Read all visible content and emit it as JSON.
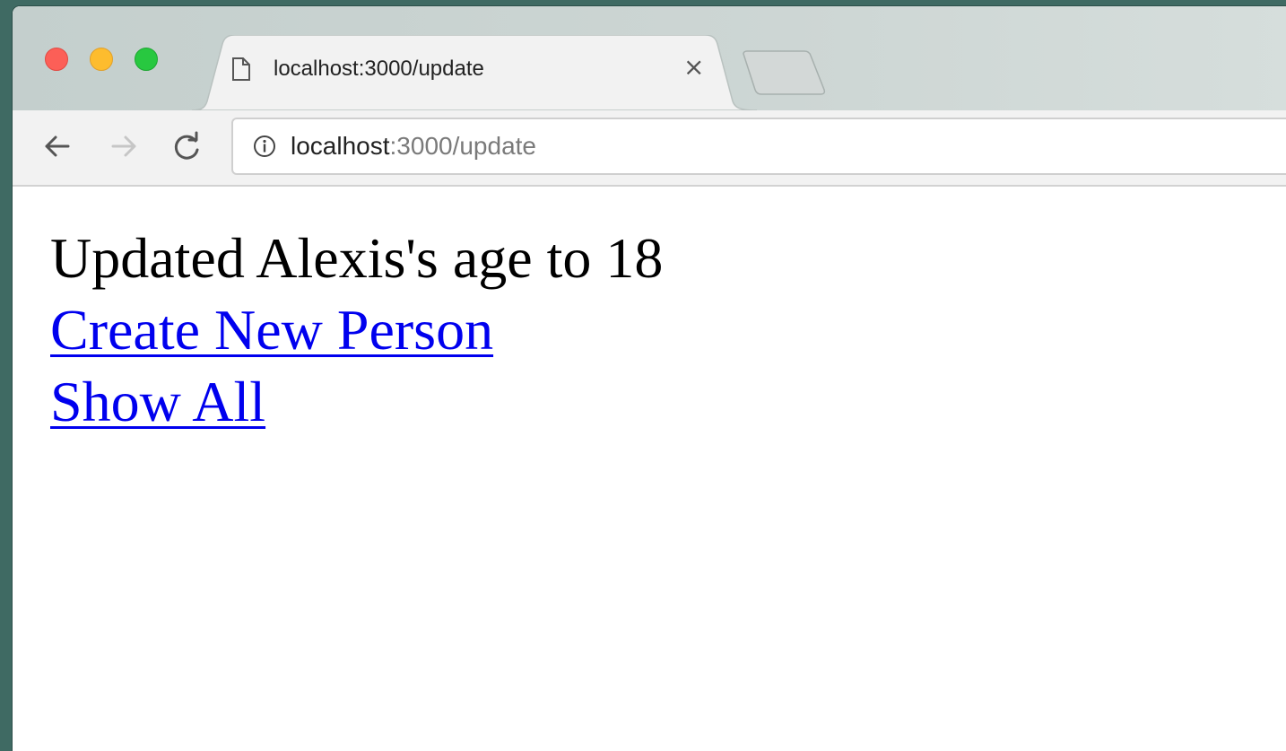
{
  "browser": {
    "tab": {
      "title": "localhost:3000/update",
      "close_label": "×"
    },
    "address_bar": {
      "host": "localhost",
      "path": ":3000/update"
    },
    "icons": {
      "close": "close-window-icon",
      "minimize": "minimize-window-icon",
      "maximize": "maximize-window-icon",
      "tab": "document-icon",
      "back": "back-arrow-icon",
      "forward": "forward-arrow-icon",
      "reload": "reload-icon",
      "info": "info-icon"
    }
  },
  "page": {
    "message": "Updated Alexis's age to 18",
    "links": {
      "create": "Create New Person",
      "show_all": "Show All"
    }
  },
  "colors": {
    "link": "#0000ee",
    "traffic_close": "#fc5f57",
    "traffic_minimize": "#fdbc2e",
    "traffic_maximize": "#28c840"
  }
}
